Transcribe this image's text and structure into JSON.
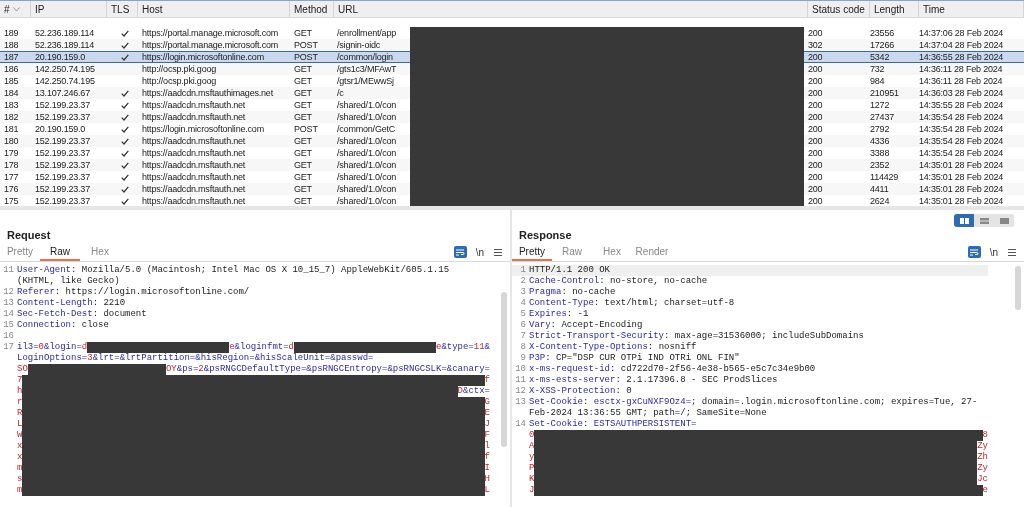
{
  "table": {
    "columns": [
      {
        "label": "#",
        "sorted": true
      },
      {
        "label": "IP"
      },
      {
        "label": "TLS"
      },
      {
        "label": "Host"
      },
      {
        "label": "Method"
      },
      {
        "label": "URL"
      },
      {
        "label": "Status code"
      },
      {
        "label": "Length"
      },
      {
        "label": "Time"
      }
    ],
    "rows": [
      {
        "number": "189",
        "ip": "52.236.189.114",
        "tls": true,
        "host": "https://portal.manage.microsoft.com",
        "method": "GET",
        "url": "/enrollment/app",
        "status": "200",
        "length": "23556",
        "time": "14:37:06 28 Feb 2024",
        "selected": false
      },
      {
        "number": "188",
        "ip": "52.236.189.114",
        "tls": true,
        "host": "https://portal.manage.microsoft.com",
        "method": "POST",
        "url": "/signin-oidc",
        "status": "302",
        "length": "17266",
        "time": "14:37:04 28 Feb 2024",
        "selected": false
      },
      {
        "number": "187",
        "ip": "20.190.159.0",
        "tls": true,
        "host": "https://login.microsoftonline.com",
        "method": "POST",
        "url": "/common/login",
        "status": "200",
        "length": "5342",
        "time": "14:36:55 28 Feb 2024",
        "selected": true
      },
      {
        "number": "186",
        "ip": "142.250.74.195",
        "tls": false,
        "host": "http://ocsp.pki.goog",
        "method": "GET",
        "url": "/gts1c3/MFAwT",
        "status": "200",
        "length": "732",
        "time": "14:36:11 28 Feb 2024",
        "selected": false
      },
      {
        "number": "185",
        "ip": "142.250.74.195",
        "tls": false,
        "host": "http://ocsp.pki.goog",
        "method": "GET",
        "url": "/gtsr1/MEwwSj",
        "status": "200",
        "length": "984",
        "time": "14:36:11 28 Feb 2024",
        "selected": false
      },
      {
        "number": "184",
        "ip": "13.107.246.67",
        "tls": true,
        "host": "https://aadcdn.msftauthimages.net",
        "method": "GET",
        "url": "/c",
        "status": "200",
        "length": "210951",
        "time": "14:36:03 28 Feb 2024",
        "selected": false
      },
      {
        "number": "183",
        "ip": "152.199.23.37",
        "tls": true,
        "host": "https://aadcdn.msftauth.net",
        "method": "GET",
        "url": "/shared/1.0/con",
        "status": "200",
        "length": "1272",
        "time": "14:35:55 28 Feb 2024",
        "selected": false
      },
      {
        "number": "182",
        "ip": "152.199.23.37",
        "tls": true,
        "host": "https://aadcdn.msftauth.net",
        "method": "GET",
        "url": "/shared/1.0/con",
        "status": "200",
        "length": "27437",
        "time": "14:35:54 28 Feb 2024",
        "selected": false
      },
      {
        "number": "181",
        "ip": "20.190.159.0",
        "tls": true,
        "host": "https://login.microsoftonline.com",
        "method": "POST",
        "url": "/common/GetC",
        "status": "200",
        "length": "2792",
        "time": "14:35:54 28 Feb 2024",
        "selected": false
      },
      {
        "number": "180",
        "ip": "152.199.23.37",
        "tls": true,
        "host": "https://aadcdn.msftauth.net",
        "method": "GET",
        "url": "/shared/1.0/con",
        "status": "200",
        "length": "4336",
        "time": "14:35:54 28 Feb 2024",
        "selected": false
      },
      {
        "number": "179",
        "ip": "152.199.23.37",
        "tls": true,
        "host": "https://aadcdn.msftauth.net",
        "method": "GET",
        "url": "/shared/1.0/con",
        "status": "200",
        "length": "3388",
        "time": "14:35:54 28 Feb 2024",
        "selected": false
      },
      {
        "number": "178",
        "ip": "152.199.23.37",
        "tls": true,
        "host": "https://aadcdn.msftauth.net",
        "method": "GET",
        "url": "/shared/1.0/con",
        "status": "200",
        "length": "2352",
        "time": "14:35:01 28 Feb 2024",
        "selected": false
      },
      {
        "number": "177",
        "ip": "152.199.23.37",
        "tls": true,
        "host": "https://aadcdn.msftauth.net",
        "method": "GET",
        "url": "/shared/1.0/con",
        "status": "200",
        "length": "114429",
        "time": "14:35:01 28 Feb 2024",
        "selected": false
      },
      {
        "number": "176",
        "ip": "152.199.23.37",
        "tls": true,
        "host": "https://aadcdn.msftauth.net",
        "method": "GET",
        "url": "/shared/1.0/con",
        "status": "200",
        "length": "4411",
        "time": "14:35:01 28 Feb 2024",
        "selected": false
      },
      {
        "number": "175",
        "ip": "152.199.23.37",
        "tls": true,
        "host": "https://aadcdn.msftauth.net",
        "method": "GET",
        "url": "/shared/1.0/con",
        "status": "200",
        "length": "2624",
        "time": "14:35:01 28 Feb 2024",
        "selected": false
      }
    ]
  },
  "request": {
    "title": "Request",
    "tabs": [
      {
        "label": "Pretty",
        "selected": false
      },
      {
        "label": "Raw",
        "selected": true
      },
      {
        "label": "Hex",
        "selected": false
      }
    ],
    "word_wrap": true,
    "newline_label": "\\n",
    "lines": [
      {
        "number": "11",
        "segments": [
          {
            "kind": "name",
            "text": "User-Agent"
          },
          {
            "kind": "plain",
            "text": ": Mozilla/5.0 (Macintosh; Intel Mac OS X 10_15_7) AppleWebKit/605.1.15 (KHTML, like Gecko)"
          }
        ]
      },
      {
        "number": "12",
        "segments": [
          {
            "kind": "name",
            "text": "Referer"
          },
          {
            "kind": "plain",
            "text": ": https://login.microsoftonline.com/"
          }
        ]
      },
      {
        "number": "13",
        "segments": [
          {
            "kind": "name",
            "text": "Content-Length"
          },
          {
            "kind": "plain",
            "text": ": 2210"
          }
        ]
      },
      {
        "number": "14",
        "segments": [
          {
            "kind": "name",
            "text": "Sec-Fetch-Dest"
          },
          {
            "kind": "plain",
            "text": ": document"
          }
        ]
      },
      {
        "number": "15",
        "segments": [
          {
            "kind": "name",
            "text": "Connection"
          },
          {
            "kind": "plain",
            "text": ": close"
          }
        ]
      },
      {
        "number": "16"
      },
      {
        "number": "17",
        "wrapped_lines": [
          {
            "segments": [
              {
                "kind": "name",
                "text": "il3="
              },
              {
                "kind": "value",
                "text": "0"
              },
              {
                "kind": "name",
                "text": "&login="
              },
              {
                "kind": "value",
                "text": "d"
              },
              {
                "kind": "redaction"
              },
              {
                "kind": "value",
                "text": "e"
              },
              {
                "kind": "name",
                "text": "&loginfmt="
              },
              {
                "kind": "value",
                "text": "d"
              },
              {
                "kind": "redaction"
              },
              {
                "kind": "value",
                "text": "e"
              },
              {
                "kind": "name",
                "text": "&type="
              },
              {
                "kind": "value",
                "text": "11"
              },
              {
                "kind": "name",
                "text": "&"
              }
            ]
          },
          {
            "segments": [
              {
                "kind": "name",
                "text": "LoginOptions="
              },
              {
                "kind": "value",
                "text": "3"
              },
              {
                "kind": "name",
                "text": "&lrt=&lrtPartition=&hisRegion=&hisScaleUnit=&passwd="
              }
            ]
          },
          {
            "segments": [
              {
                "kind": "value",
                "text": "SO"
              },
              {
                "kind": "redaction"
              },
              {
                "kind": "value",
                "text": "OY"
              },
              {
                "kind": "name",
                "text": "&ps="
              },
              {
                "kind": "value",
                "text": "2"
              },
              {
                "kind": "name",
                "text": "&psRNGCDefaultType=&psRNGCEntropy=&psRNGCSLK=&canary="
              }
            ]
          },
          {
            "segments": [
              {
                "kind": "value",
                "text": "7"
              },
              {
                "kind": "redaction"
              },
              {
                "kind": "value",
                "text": "f"
              }
            ]
          },
          {
            "segments": [
              {
                "kind": "value",
                "text": "h"
              },
              {
                "kind": "redaction"
              },
              {
                "kind": "value",
                "text": "D"
              },
              {
                "kind": "name",
                "text": "&ctx="
              }
            ]
          },
          {
            "segments": [
              {
                "kind": "value",
                "text": "r"
              },
              {
                "kind": "redaction"
              },
              {
                "kind": "value",
                "text": "G"
              }
            ]
          },
          {
            "segments": [
              {
                "kind": "value",
                "text": "R"
              },
              {
                "kind": "redaction"
              },
              {
                "kind": "value",
                "text": "E"
              }
            ]
          },
          {
            "segments": [
              {
                "kind": "value",
                "text": "L"
              },
              {
                "kind": "redaction"
              },
              {
                "kind": "value",
                "text": "J"
              }
            ]
          },
          {
            "segments": [
              {
                "kind": "value",
                "text": "W"
              },
              {
                "kind": "redaction"
              },
              {
                "kind": "value",
                "text": "F"
              }
            ]
          },
          {
            "segments": [
              {
                "kind": "value",
                "text": "x"
              },
              {
                "kind": "redaction"
              },
              {
                "kind": "value",
                "text": "l"
              }
            ]
          },
          {
            "segments": [
              {
                "kind": "value",
                "text": "x"
              },
              {
                "kind": "redaction"
              },
              {
                "kind": "value",
                "text": "f"
              }
            ]
          },
          {
            "segments": [
              {
                "kind": "value",
                "text": "m"
              },
              {
                "kind": "redaction"
              },
              {
                "kind": "value",
                "text": "I"
              }
            ]
          },
          {
            "segments": [
              {
                "kind": "value",
                "text": "s"
              },
              {
                "kind": "redaction"
              },
              {
                "kind": "value",
                "text": "H"
              }
            ]
          },
          {
            "segments": [
              {
                "kind": "value",
                "text": "m"
              },
              {
                "kind": "redaction"
              },
              {
                "kind": "value",
                "text": "L"
              }
            ]
          }
        ]
      }
    ]
  },
  "response": {
    "title": "Response",
    "layout_toggle": [
      {
        "selected": true
      },
      {
        "selected": false
      },
      {
        "selected": false
      }
    ],
    "tabs": [
      {
        "label": "Pretty",
        "selected": true
      },
      {
        "label": "Raw",
        "selected": false
      },
      {
        "label": "Hex",
        "selected": false
      },
      {
        "label": "Render",
        "selected": false
      }
    ],
    "word_wrap": true,
    "newline_label": "\\n",
    "lines": [
      {
        "number": "1",
        "current": true,
        "segments": [
          {
            "kind": "plain",
            "text": "HTTP/1.1 200 OK"
          }
        ]
      },
      {
        "number": "2",
        "current": false,
        "segments": [
          {
            "kind": "name",
            "text": "Cache-Control"
          },
          {
            "kind": "plain",
            "text": ": no-store, no-cache"
          }
        ]
      },
      {
        "number": "3",
        "current": false,
        "segments": [
          {
            "kind": "name",
            "text": "Pragma"
          },
          {
            "kind": "plain",
            "text": ": no-cache"
          }
        ]
      },
      {
        "number": "4",
        "current": false,
        "segments": [
          {
            "kind": "name",
            "text": "Content-Type"
          },
          {
            "kind": "plain",
            "text": ": text/html; charset=utf-8"
          }
        ]
      },
      {
        "number": "5",
        "current": false,
        "segments": [
          {
            "kind": "name",
            "text": "Expires"
          },
          {
            "kind": "plain",
            "text": ": -1"
          }
        ]
      },
      {
        "number": "6",
        "current": false,
        "segments": [
          {
            "kind": "name",
            "text": "Vary"
          },
          {
            "kind": "plain",
            "text": ": Accept-Encoding"
          }
        ]
      },
      {
        "number": "7",
        "current": false,
        "segments": [
          {
            "kind": "name",
            "text": "Strict-Transport-Security"
          },
          {
            "kind": "plain",
            "text": ": max-age=31536000; includeSubDomains"
          }
        ]
      },
      {
        "number": "8",
        "current": false,
        "segments": [
          {
            "kind": "name",
            "text": "X-Content-Type-Options"
          },
          {
            "kind": "plain",
            "text": ": nosniff"
          }
        ]
      },
      {
        "number": "9",
        "current": false,
        "segments": [
          {
            "kind": "name",
            "text": "P3P"
          },
          {
            "kind": "plain",
            "text": ": CP=\"DSP CUR OTPi IND OTRi ONL FIN\""
          }
        ]
      },
      {
        "number": "10",
        "current": false,
        "segments": [
          {
            "kind": "name",
            "text": "x-ms-request-id"
          },
          {
            "kind": "plain",
            "text": ": cd722d70-2f56-4e38-b565-e5c7c34e9b00"
          }
        ]
      },
      {
        "number": "11",
        "current": false,
        "segments": [
          {
            "kind": "name",
            "text": "x-ms-ests-server"
          },
          {
            "kind": "plain",
            "text": ": 2.1.17396.8 - SEC ProdSlices"
          }
        ]
      },
      {
        "number": "12",
        "current": false,
        "segments": [
          {
            "kind": "name",
            "text": "X-XSS-Protection"
          },
          {
            "kind": "plain",
            "text": ": 0"
          }
        ]
      },
      {
        "number": "13",
        "current": false,
        "segments": [
          {
            "kind": "name",
            "text": "Set-Cookie"
          },
          {
            "kind": "plain",
            "text": ": "
          },
          {
            "kind": "name",
            "text": "esctx-gxCuNXF9Oz4="
          },
          {
            "kind": "plain",
            "text": "; domain=.login.microsoftonline.com; expires=Tue, 27-Feb-2024 13:36:55 GMT; path=/; SameSite=None"
          }
        ]
      },
      {
        "number": "14",
        "current": false,
        "wrapped_lines": [
          {
            "segments": [
              {
                "kind": "name",
                "text": "Set-Cookie"
              },
              {
                "kind": "plain",
                "text": ": "
              },
              {
                "kind": "name",
                "text": "ESTSAUTHPERSISTENT="
              }
            ]
          },
          {
            "segments": [
              {
                "kind": "value",
                "text": "0"
              },
              {
                "kind": "redaction"
              },
              {
                "kind": "value",
                "text": "8"
              }
            ]
          },
          {
            "segments": [
              {
                "kind": "value",
                "text": "A"
              },
              {
                "kind": "redaction"
              },
              {
                "kind": "value",
                "text": "Zy"
              }
            ]
          },
          {
            "segments": [
              {
                "kind": "value",
                "text": "y"
              },
              {
                "kind": "redaction"
              },
              {
                "kind": "value",
                "text": "Zh"
              }
            ]
          },
          {
            "segments": [
              {
                "kind": "value",
                "text": "P"
              },
              {
                "kind": "redaction"
              },
              {
                "kind": "value",
                "text": "Zy"
              }
            ]
          },
          {
            "segments": [
              {
                "kind": "value",
                "text": "K"
              },
              {
                "kind": "redaction"
              },
              {
                "kind": "value",
                "text": "Jc"
              }
            ]
          },
          {
            "segments": [
              {
                "kind": "value",
                "text": "J"
              },
              {
                "kind": "redaction"
              },
              {
                "kind": "value",
                "text": "e"
              }
            ]
          }
        ]
      }
    ]
  }
}
